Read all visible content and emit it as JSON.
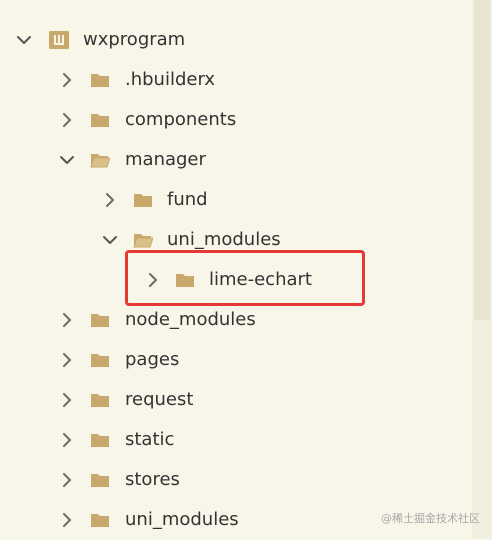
{
  "tree": {
    "root": {
      "label": "wxprogram",
      "icon": "project-icon",
      "expanded": true
    },
    "items": [
      {
        "label": ".hbuilderx",
        "icon": "folder-icon",
        "expanded": false
      },
      {
        "label": "components",
        "icon": "folder-icon",
        "expanded": false
      },
      {
        "label": "manager",
        "icon": "folder-open-icon",
        "expanded": true
      },
      {
        "label": "fund",
        "icon": "folder-icon",
        "expanded": false
      },
      {
        "label": "uni_modules",
        "icon": "folder-open-icon",
        "expanded": true
      },
      {
        "label": "lime-echart",
        "icon": "folder-icon",
        "expanded": false
      },
      {
        "label": "node_modules",
        "icon": "folder-icon",
        "expanded": false
      },
      {
        "label": "pages",
        "icon": "folder-icon",
        "expanded": false
      },
      {
        "label": "request",
        "icon": "folder-icon",
        "expanded": false
      },
      {
        "label": "static",
        "icon": "folder-icon",
        "expanded": false
      },
      {
        "label": "stores",
        "icon": "folder-icon",
        "expanded": false
      },
      {
        "label": "uni_modules",
        "icon": "folder-icon",
        "expanded": false
      }
    ]
  },
  "colors": {
    "background": "#f8f5e9",
    "folder": "#c9a96b",
    "chevron": "#6b6b6b",
    "highlight": "#e53935",
    "text": "#333333"
  },
  "watermark": "@稀土掘金技术社区"
}
